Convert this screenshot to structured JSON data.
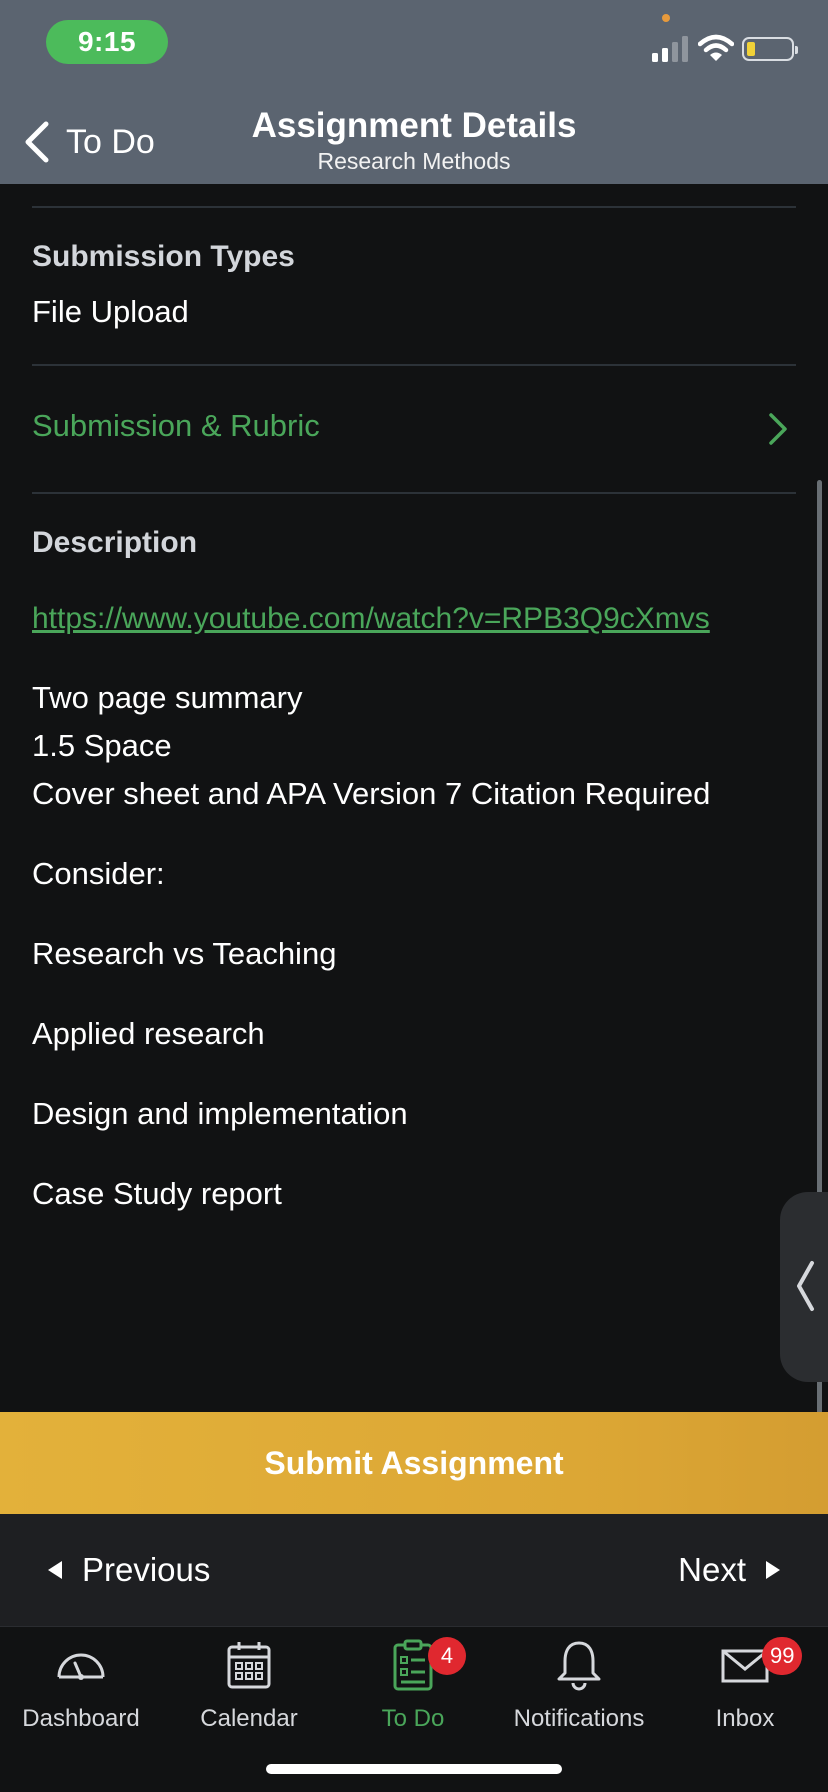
{
  "status_bar": {
    "time": "9:15"
  },
  "nav": {
    "back_label": "To Do",
    "title": "Assignment Details",
    "subtitle": "Research Methods"
  },
  "assignment": {
    "submission_types_label": "Submission Types",
    "submission_types_value": "File Upload",
    "rubric_link": "Submission & Rubric",
    "description_label": "Description",
    "description_link": "https://www.youtube.com/watch?v=RPB3Q9cXmvs",
    "description_lines": [
      "Two page summary",
      "1.5 Space",
      "Cover sheet and APA Version 7 Citation Required",
      "Consider:",
      "Research vs Teaching",
      "Applied research",
      "Design and implementation",
      "Case Study report"
    ]
  },
  "actions": {
    "submit_label": "Submit Assignment",
    "previous_label": "Previous",
    "next_label": "Next"
  },
  "tabbar": {
    "items": [
      {
        "label": "Dashboard",
        "icon": "dashboard-gauge-icon"
      },
      {
        "label": "Calendar",
        "icon": "calendar-icon"
      },
      {
        "label": "To Do",
        "icon": "todo-clipboard-icon",
        "badge": "4",
        "active": true
      },
      {
        "label": "Notifications",
        "icon": "bell-icon"
      },
      {
        "label": "Inbox",
        "icon": "envelope-icon",
        "badge": "99"
      }
    ]
  },
  "colors": {
    "header_bg": "#5b6470",
    "accent_green": "#4aa65a",
    "submit_yellow": "#dca735",
    "badge_red": "#e0282f",
    "time_pill_green": "#4cbb5b"
  }
}
